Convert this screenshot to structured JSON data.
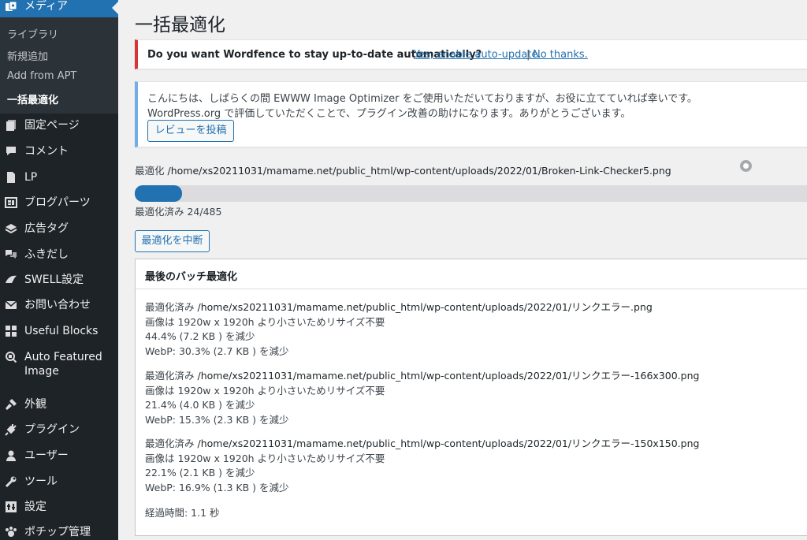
{
  "sidebar": {
    "media": {
      "label": "メディア",
      "icon": "media-icon"
    },
    "submenu": [
      {
        "label": "ライブラリ",
        "current": false
      },
      {
        "label": "新規追加",
        "current": false
      },
      {
        "label": "Add from APT",
        "current": false
      },
      {
        "label": "一括最適化",
        "current": true
      }
    ],
    "items": [
      {
        "label": "固定ページ",
        "icon": "pages-icon"
      },
      {
        "label": "コメント",
        "icon": "comments-icon"
      },
      {
        "label": "LP",
        "icon": "lp-page-icon"
      },
      {
        "label": "ブログパーツ",
        "icon": "blog-parts-icon"
      },
      {
        "label": "広告タグ",
        "icon": "ad-tag-icon"
      },
      {
        "label": "ふきだし",
        "icon": "balloon-icon"
      },
      {
        "label": "SWELL設定",
        "icon": "swell-icon"
      },
      {
        "label": "お問い合わせ",
        "icon": "mail-icon"
      },
      {
        "label": "Useful Blocks",
        "icon": "blocks-icon"
      },
      {
        "label": "Auto Featured",
        "label2": "Image",
        "icon": "auto-featured-image-icon"
      },
      {
        "label": "外観",
        "icon": "appearance-icon"
      },
      {
        "label": "プラグイン",
        "icon": "plugins-icon"
      },
      {
        "label": "ユーザー",
        "icon": "users-icon"
      },
      {
        "label": "ツール",
        "icon": "tools-icon"
      },
      {
        "label": "設定",
        "icon": "settings-icon"
      },
      {
        "label": "ポチップ管理",
        "icon": "pochipp-icon"
      }
    ]
  },
  "page": {
    "title": "一括最適化"
  },
  "wordfence_notice": {
    "message": "Do you want Wordfence to stay up-to-date automatically?",
    "yes_link": "Yes, enable auto-update.",
    "separator": "|",
    "no_link": "No thanks."
  },
  "ewww_notice": {
    "line1": "こんにちは、しばらくの間 EWWW Image Optimizer をご使用いただいておりますが、お役に立てていれば幸いです。",
    "line2": "WordPress.org で評価していただくことで、プラグイン改善の助けになります。ありがとうございます。",
    "review_button": "レビューを投稿"
  },
  "optimizing": {
    "prefix": "最適化",
    "path": "/home/xs20211031/mamame.net/public_html/wp-content/uploads/2022/01/Broken-Link-Checker5.png"
  },
  "progress": {
    "done": 24,
    "total": 485,
    "fraction": 0.0495,
    "text": "最適化済み 24/485"
  },
  "stop_button": "最適化を中断",
  "last_batch": {
    "title": "最後のバッチ最適化",
    "entries": [
      {
        "prefix": "最適化済み",
        "path": "/home/xs20211031/mamame.net/public_html/wp-content/uploads/2022/01/リンクエラー.png",
        "resize_note": "画像は 1920w x 1920h より小さいためリサイズ不要",
        "reduction": "44.4% (7.2 KB ) を減少",
        "webp": "WebP: 30.3% (2.7 KB ) を減少"
      },
      {
        "prefix": "最適化済み",
        "path": "/home/xs20211031/mamame.net/public_html/wp-content/uploads/2022/01/リンクエラー-166x300.png",
        "resize_note": "画像は 1920w x 1920h より小さいためリサイズ不要",
        "reduction": "21.4% (4.0 KB ) を減少",
        "webp": "WebP: 15.3% (2.3 KB ) を減少"
      },
      {
        "prefix": "最適化済み",
        "path": "/home/xs20211031/mamame.net/public_html/wp-content/uploads/2022/01/リンクエラー-150x150.png",
        "resize_note": "画像は 1920w x 1920h より小さいためリサイズ不要",
        "reduction": "22.1% (2.1 KB ) を減少",
        "webp": "WebP: 16.9% (1.3 KB ) を減少"
      }
    ],
    "elapsed": "経過時間: 1.1 秒"
  },
  "colors": {
    "sidebar_bg": "#1d2327",
    "submenu_bg": "#2c3338",
    "accent": "#2271b1",
    "error_border": "#d63638",
    "info_border": "#72aee6"
  }
}
